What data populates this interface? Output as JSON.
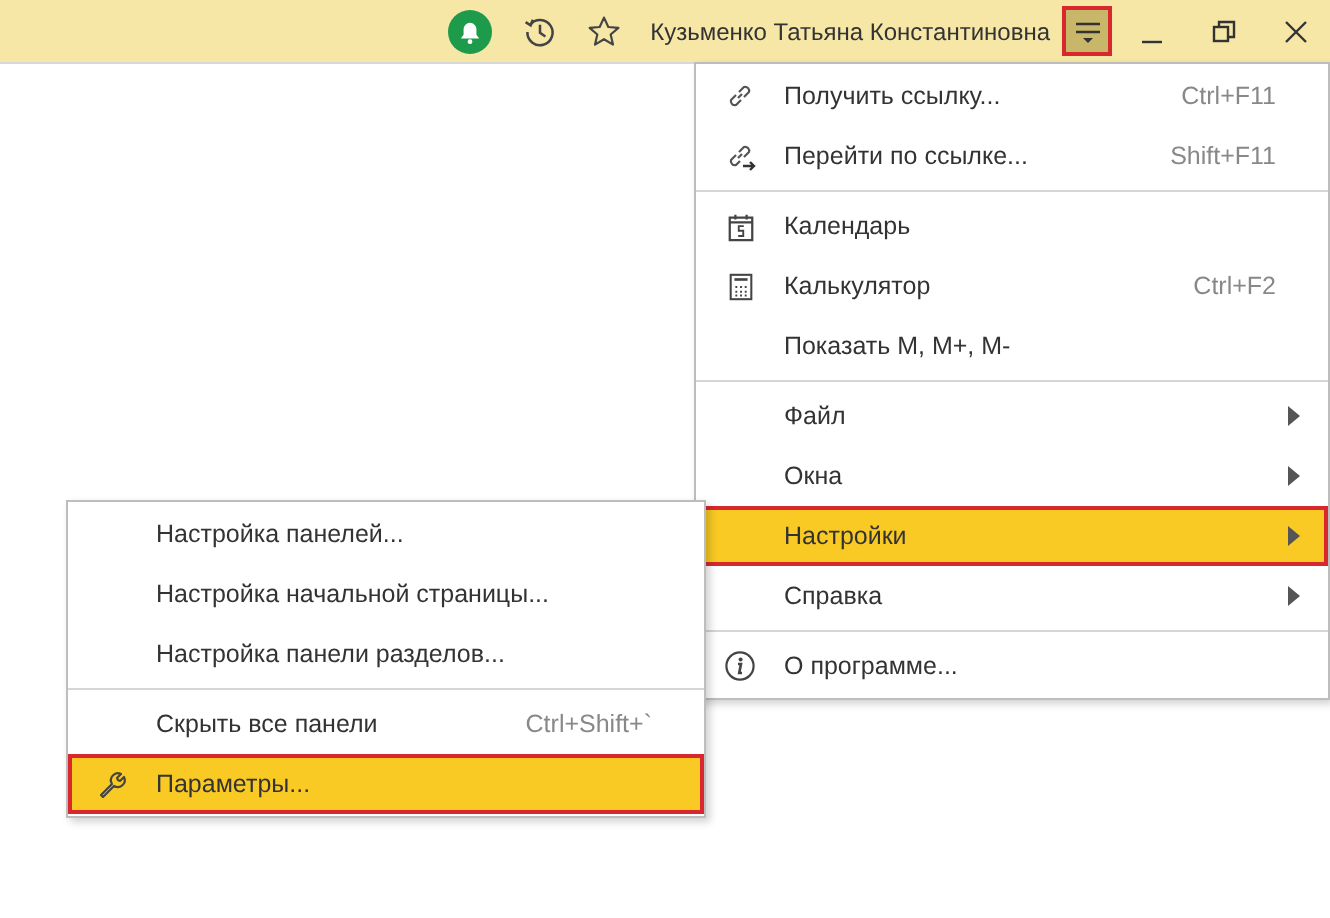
{
  "toolbar": {
    "user_name": "Кузьменко Татьяна Константиновна",
    "menu_button_active": true
  },
  "main_menu": [
    {
      "kind": "link",
      "label": "Получить ссылку...",
      "shortcut": "Ctrl+F11",
      "submenu": false,
      "selected": false
    },
    {
      "kind": "goto",
      "label": "Перейти по ссылке...",
      "shortcut": "Shift+F11",
      "submenu": false,
      "selected": false
    },
    {
      "kind": "separator"
    },
    {
      "kind": "calendar",
      "label": "Календарь",
      "submenu": false,
      "selected": false
    },
    {
      "kind": "calculator",
      "label": "Калькулятор",
      "shortcut": "Ctrl+F2",
      "submenu": false,
      "selected": false
    },
    {
      "kind": "plain",
      "label": "Показать M, M+, M-",
      "submenu": false,
      "selected": false
    },
    {
      "kind": "separator"
    },
    {
      "kind": "plain",
      "label": "Файл",
      "submenu": true,
      "selected": false
    },
    {
      "kind": "plain",
      "label": "Окна",
      "submenu": true,
      "selected": false
    },
    {
      "kind": "plain",
      "label": "Настройки",
      "submenu": true,
      "selected": true
    },
    {
      "kind": "plain",
      "label": "Справка",
      "submenu": true,
      "selected": false
    },
    {
      "kind": "separator"
    },
    {
      "kind": "info",
      "label": "О программе...",
      "submenu": false,
      "selected": false
    }
  ],
  "settings_submenu": [
    {
      "kind": "plain",
      "label": "Настройка панелей...",
      "selected": false
    },
    {
      "kind": "plain",
      "label": "Настройка начальной страницы...",
      "selected": false
    },
    {
      "kind": "plain",
      "label": "Настройка панели разделов...",
      "selected": false
    },
    {
      "kind": "separator"
    },
    {
      "kind": "plain",
      "label": "Скрыть все панели",
      "shortcut": "Ctrl+Shift+`",
      "selected": false
    },
    {
      "kind": "wrench",
      "label": "Параметры...",
      "selected": true
    }
  ]
}
